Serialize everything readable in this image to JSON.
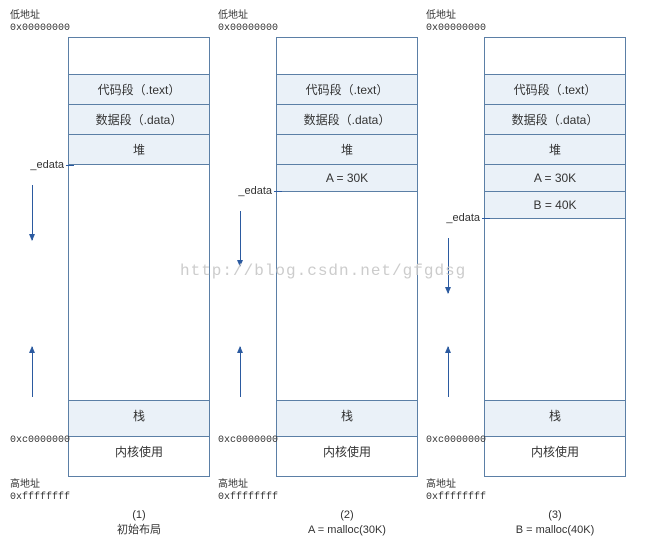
{
  "labels": {
    "low_addr": "低地址",
    "high_addr": "高地址",
    "addr_low_hex": "0x00000000",
    "addr_stack_hex": "0xc0000000",
    "addr_high_hex": "0xffffffff",
    "edata": "_edata",
    "text_seg": "代码段（.text）",
    "data_seg": "数据段（.data）",
    "heap": "堆",
    "stack": "栈",
    "kernel": "内核使用",
    "alloc_a": "A = 30K",
    "alloc_b": "B = 40K"
  },
  "captions": {
    "c1_num": "(1)",
    "c1_txt": "初始布局",
    "c2_num": "(2)",
    "c2_txt": "A = malloc(30K)",
    "c3_num": "(3)",
    "c3_txt": "B = malloc(40K)"
  },
  "watermark": "http://blog.csdn.net/gfgdsg",
  "chart_data": {
    "type": "table",
    "title": "Process virtual memory layout across three states (low→high address)",
    "address_range": {
      "low": "0x00000000",
      "stack_top": "0xc0000000",
      "high": "0xffffffff"
    },
    "panels": [
      {
        "id": 1,
        "caption": "初始布局",
        "segments_low_to_high": [
          "(blank)",
          "代码段（.text）",
          "数据段（.data）",
          "堆",
          "(free gap)",
          "栈",
          "内核使用"
        ],
        "edata_after": "堆"
      },
      {
        "id": 2,
        "caption": "A = malloc(30K)",
        "segments_low_to_high": [
          "(blank)",
          "代码段（.text）",
          "数据段（.data）",
          "堆",
          "A = 30K",
          "(free gap)",
          "栈",
          "内核使用"
        ],
        "edata_after": "A = 30K"
      },
      {
        "id": 3,
        "caption": "B = malloc(40K)",
        "segments_low_to_high": [
          "(blank)",
          "代码段（.text）",
          "数据段（.data）",
          "堆",
          "A = 30K",
          "B = 40K",
          "(free gap)",
          "栈",
          "内核使用"
        ],
        "edata_after": "B = 40K"
      }
    ]
  }
}
